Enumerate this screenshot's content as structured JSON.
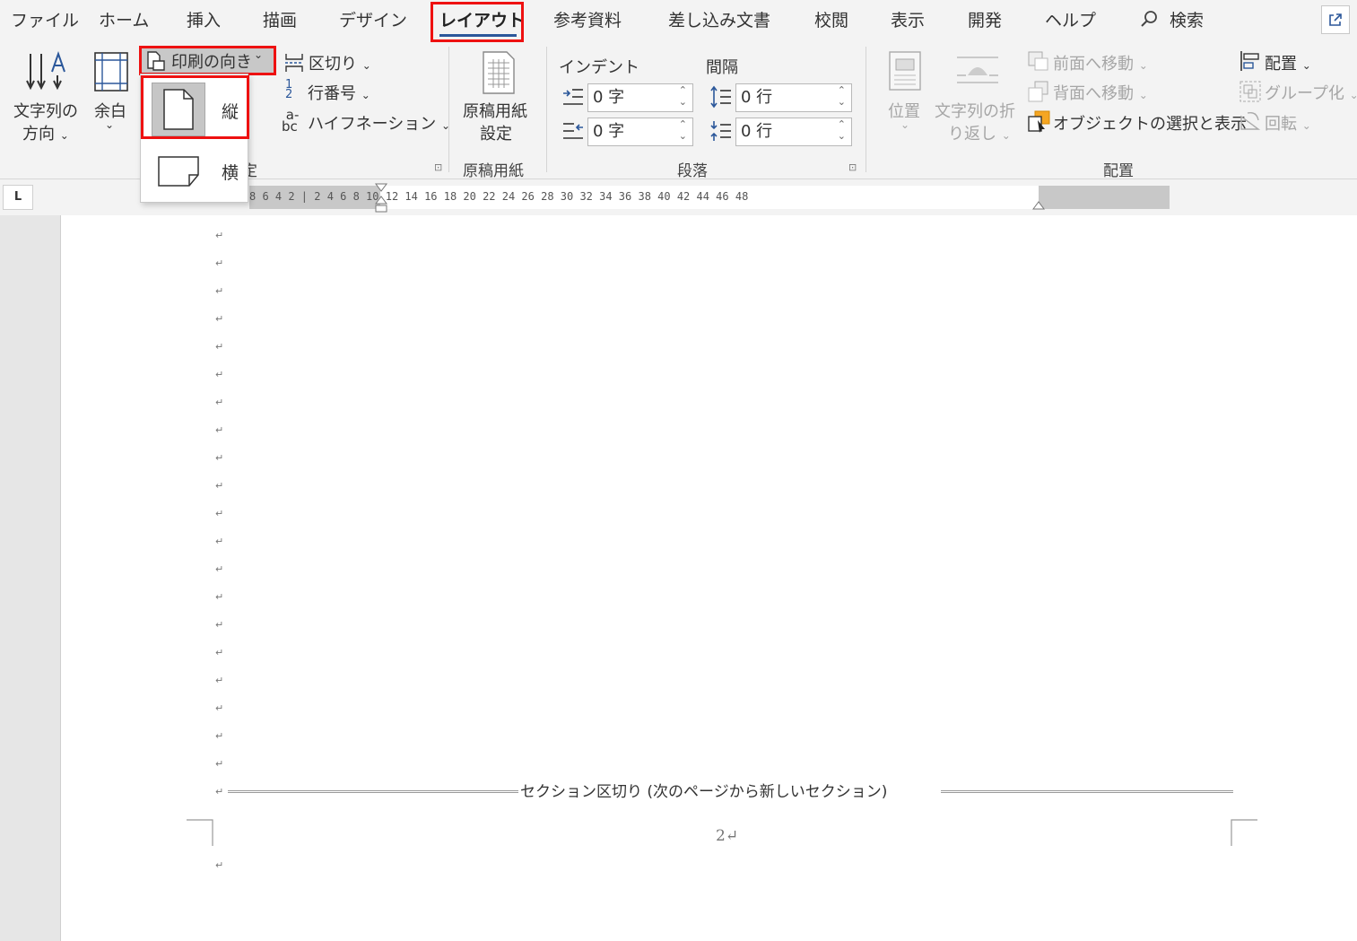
{
  "tabs": [
    "ファイル",
    "ホーム",
    "挿入",
    "描画",
    "デザイン",
    "レイアウト",
    "参考資料",
    "差し込み文書",
    "校閲",
    "表示",
    "開発",
    "ヘルプ"
  ],
  "active_tab": "レイアウト",
  "search_label": "検索",
  "ribbon": {
    "page_setup": {
      "text_direction_1": "文字列の",
      "text_direction_2": "方向",
      "margins": "余白",
      "orientation": "印刷の向き",
      "breaks": "区切り",
      "line_numbers": "行番号",
      "hyphenation": "ハイフネーション",
      "group_label_tail": "定"
    },
    "genko": {
      "button_1": "原稿用紙",
      "button_2": "設定",
      "group_label": "原稿用紙"
    },
    "paragraph": {
      "indent_label": "インデント",
      "spacing_label": "間隔",
      "indent_left": "0 字",
      "indent_right": "0 字",
      "spacing_before": "0 行",
      "spacing_after": "0 行",
      "group_label": "段落"
    },
    "arrange": {
      "position": "位置",
      "wrap_1": "文字列の折",
      "wrap_2": "り返し",
      "bring_forward": "前面へ移動",
      "send_backward": "背面へ移動",
      "selection_pane": "オブジェクトの選択と表示",
      "align": "配置",
      "group": "グループ化",
      "rotate": "回転",
      "group_label": "配置"
    }
  },
  "orientation_menu": {
    "portrait": "縦",
    "landscape": "横"
  },
  "ruler": {
    "corner": "L",
    "labels": "8  6  4  2  |  2  4  6  8  10  12  14  16  18  20  22  24  26  28  30  32  34  36  38  40  42  44  46  48"
  },
  "document": {
    "paragraph_mark": "↵",
    "section_break": "セクション区切り (次のページから新しいセクション)",
    "page_number": "2↵"
  },
  "colors": {
    "highlight": "#e11111",
    "accent": "#2b579a"
  }
}
